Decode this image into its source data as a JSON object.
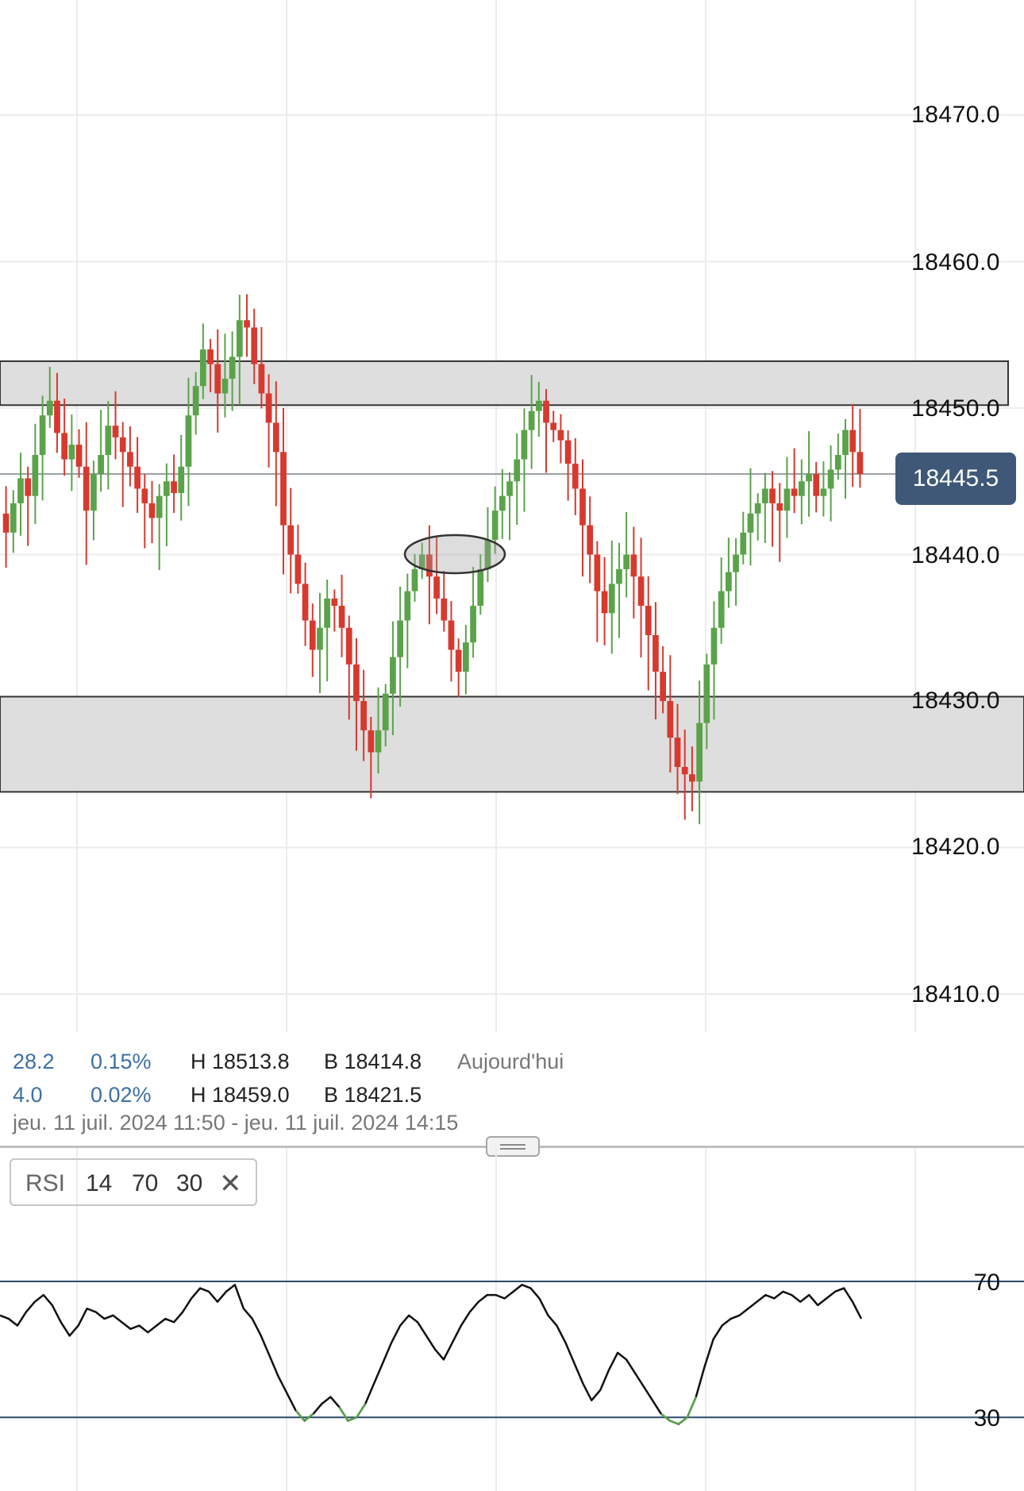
{
  "price_axis": {
    "labels": [
      "18470.0",
      "18460.0",
      "18450.0",
      "18440.0",
      "18430.0",
      "18420.0",
      "18410.0"
    ],
    "current_price": "18445.5"
  },
  "colors": {
    "up": "#5aa34a",
    "down": "#d7392f",
    "zone": "#dcdcdc",
    "current_price_bg": "#3f5878",
    "rsi_line": "#111111",
    "rsi_band": "#2c4a6e"
  },
  "stats": {
    "row1": {
      "change": "28.2",
      "pct": "0.15%",
      "high": "H 18513.8",
      "low": "B 18414.8",
      "period": "Aujourd'hui"
    },
    "row2": {
      "change": "4.0",
      "pct": "0.02%",
      "high": "H 18459.0",
      "low": "B 18421.5"
    }
  },
  "date_range": "jeu. 11 juil. 2024 11:50 - jeu. 11 juil. 2024 14:15",
  "rsi": {
    "name": "RSI",
    "period": "14",
    "upper": "70",
    "lower": "30",
    "close_icon": "close-icon",
    "levels": [
      "70",
      "30"
    ]
  },
  "chart_data": {
    "type": "candlestick",
    "ylim": [
      18403.0,
      18478.0
    ],
    "zones": [
      {
        "from": 18450.2,
        "to": 18453.2
      },
      {
        "from": 18423.8,
        "to": 18430.3
      }
    ],
    "current_price": 18445.5,
    "path": [
      18442.8,
      18441.5,
      18443.5,
      18445.2,
      18444.0,
      18446.8,
      18449.5,
      18450.5,
      18448.3,
      18446.5,
      18447.5,
      18446.0,
      18443.0,
      18445.5,
      18446.8,
      18448.8,
      18448.0,
      18447.0,
      18446.0,
      18444.5,
      18443.5,
      18442.5,
      18444.0,
      18445.0,
      18444.2,
      18446.0,
      18449.5,
      18451.5,
      18454.0,
      18453.0,
      18451.0,
      18452.0,
      18453.5,
      18456.0,
      18455.5,
      18453.0,
      18451.0,
      18449.0,
      18447.0,
      18442.0,
      18440.0,
      18438.0,
      18435.5,
      18433.5,
      18435.0,
      18437.0,
      18436.5,
      18435.0,
      18432.5,
      18430.0,
      18428.0,
      18426.5,
      18428.0,
      18430.5,
      18433.0,
      18435.5,
      18437.5,
      18439.0,
      18440.0,
      18438.5,
      18437.0,
      18435.5,
      18433.5,
      18432.0,
      18434.0,
      18436.5,
      18439.0,
      18441.0,
      18443.0,
      18444.0,
      18445.0,
      18446.5,
      18448.5,
      18449.8,
      18450.5,
      18449.0,
      18448.5,
      18447.8,
      18446.2,
      18444.5,
      18442.0,
      18440.0,
      18437.5,
      18436.0,
      18438.0,
      18439.0,
      18440.0,
      18438.5,
      18436.5,
      18434.5,
      18432.0,
      18430.0,
      18427.5,
      18425.5,
      18425.0,
      18424.5,
      18428.5,
      18432.5,
      18435.0,
      18437.5,
      18438.8,
      18440.0,
      18441.5,
      18442.8,
      18443.5,
      18444.5,
      18443.5,
      18443.0,
      18444.5,
      18444.0,
      18445.0,
      18445.5,
      18444.0,
      18444.5,
      18445.8,
      18446.8,
      18448.5,
      18447.0,
      18445.5
    ],
    "rsi_path": [
      60,
      59,
      57,
      61,
      64,
      66,
      63,
      58,
      54,
      57,
      62,
      61,
      59,
      60,
      58,
      56,
      57,
      55,
      57,
      59,
      58,
      61,
      65,
      68,
      67,
      64,
      67,
      69,
      62,
      59,
      54,
      48,
      42,
      37,
      32,
      29,
      31,
      34,
      36,
      33,
      29,
      30,
      34,
      40,
      46,
      52,
      57,
      60,
      58,
      54,
      50,
      47,
      52,
      57,
      61,
      64,
      66,
      66,
      65,
      67,
      69,
      68,
      65,
      60,
      57,
      52,
      46,
      40,
      35,
      38,
      44,
      49,
      47,
      43,
      39,
      35,
      31,
      29,
      28,
      30,
      36,
      45,
      53,
      57,
      59,
      60,
      62,
      64,
      66,
      65,
      67,
      66,
      64,
      66,
      63,
      65,
      67,
      68,
      64,
      59
    ]
  }
}
